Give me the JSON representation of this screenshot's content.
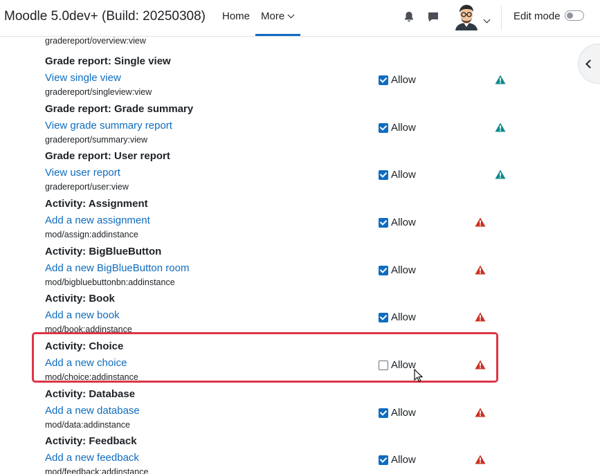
{
  "navbar": {
    "brand": "Moodle 5.0dev+ (Build: 20250308)",
    "home": "Home",
    "more": "More",
    "edit_mode": "Edit mode",
    "edit_mode_on": false
  },
  "fragment_capability": "gradereport/overview:view",
  "allow_label": "Allow",
  "colors": {
    "link": "#0f6cbf",
    "risk_teal": "#0f8a8a",
    "risk_red": "#ca3120",
    "highlight": "#dc3545"
  },
  "rows": [
    {
      "component": "Grade report: Single view",
      "action": "View single view",
      "capability": "gradereport/singleview:view",
      "allowed": true,
      "risk": "teal"
    },
    {
      "component": "Grade report: Grade summary",
      "action": "View grade summary report",
      "capability": "gradereport/summary:view",
      "allowed": true,
      "risk": "teal"
    },
    {
      "component": "Grade report: User report",
      "action": "View user report",
      "capability": "gradereport/user:view",
      "allowed": true,
      "risk": "teal"
    },
    {
      "component": "Activity: Assignment",
      "action": "Add a new assignment",
      "capability": "mod/assign:addinstance",
      "allowed": true,
      "risk": "red"
    },
    {
      "component": "Activity: BigBlueButton",
      "action": "Add a new BigBlueButton room",
      "capability": "mod/bigbluebuttonbn:addinstance",
      "allowed": true,
      "risk": "red"
    },
    {
      "component": "Activity: Book",
      "action": "Add a new book",
      "capability": "mod/book:addinstance",
      "allowed": true,
      "risk": "red"
    },
    {
      "component": "Activity: Choice",
      "action": "Add a new choice",
      "capability": "mod/choice:addinstance",
      "allowed": false,
      "risk": "red"
    },
    {
      "component": "Activity: Database",
      "action": "Add a new database",
      "capability": "mod/data:addinstance",
      "allowed": true,
      "risk": "red"
    },
    {
      "component": "Activity: Feedback",
      "action": "Add a new feedback",
      "capability": "mod/feedback:addinstance",
      "allowed": true,
      "risk": "red"
    }
  ]
}
